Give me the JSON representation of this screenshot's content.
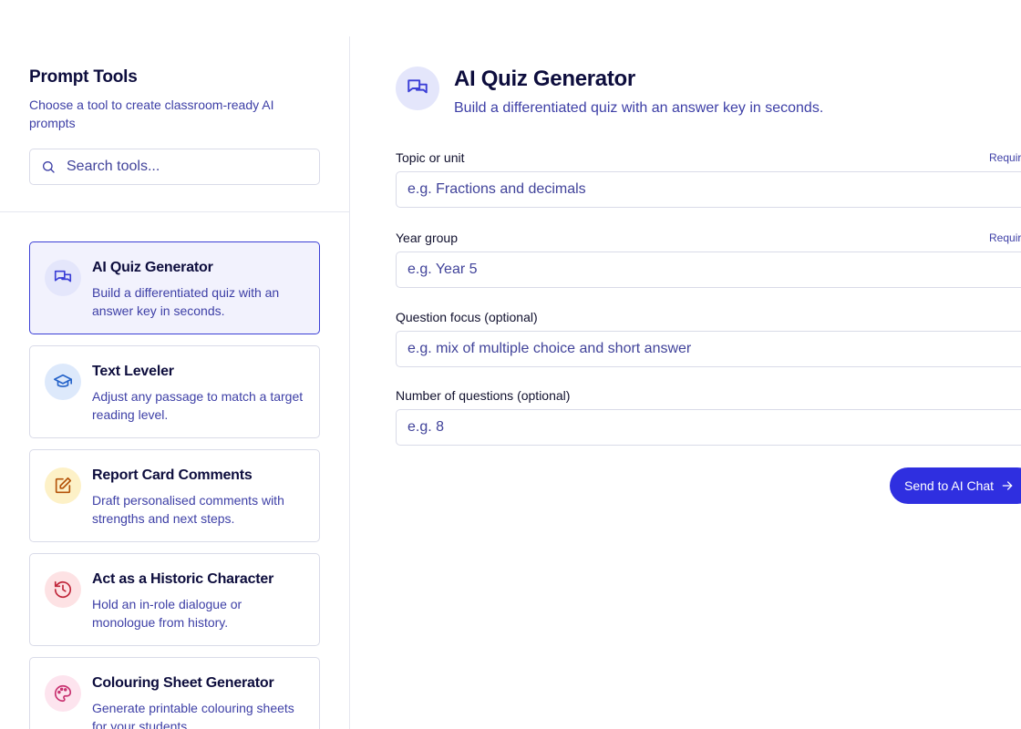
{
  "sidebar": {
    "title": "Prompt Tools",
    "subtitle": "Choose a tool to create classroom-ready AI prompts",
    "search_placeholder": "Search tools...",
    "tools": [
      {
        "name": "AI Quiz Generator",
        "description": "Build a differentiated quiz with an answer key in seconds.",
        "icon": "chat-bubbles-icon",
        "color": "#3b3fd6",
        "bg": "#e4e6fb",
        "active": true
      },
      {
        "name": "Text Leveler",
        "description": "Adjust any passage to match a target reading level.",
        "icon": "graduation-cap-icon",
        "color": "#2563c9",
        "bg": "#dde9fb",
        "active": false
      },
      {
        "name": "Report Card Comments",
        "description": "Draft personalised comments with strengths and next steps.",
        "icon": "edit-icon",
        "color": "#b45309",
        "bg": "#fdf1c7",
        "active": false
      },
      {
        "name": "Act as a Historic Character",
        "description": "Hold an in-role dialogue or monologue from history.",
        "icon": "history-icon",
        "color": "#c0263a",
        "bg": "#fde2e4",
        "active": false
      },
      {
        "name": "Colouring Sheet Generator",
        "description": "Generate printable colouring sheets for your students.",
        "icon": "palette-icon",
        "color": "#c8306f",
        "bg": "#fde4ee",
        "active": false
      }
    ]
  },
  "main": {
    "title": "AI Quiz Generator",
    "subtitle": "Build a differentiated quiz with an answer key in seconds.",
    "required_label": "Required",
    "fields": [
      {
        "label": "Topic or unit",
        "placeholder": "e.g. Fractions and decimals",
        "required": true
      },
      {
        "label": "Year group",
        "placeholder": "e.g. Year 5",
        "required": true
      },
      {
        "label": "Question focus (optional)",
        "placeholder": "e.g. mix of multiple choice and short answer",
        "required": false
      },
      {
        "label": "Number of questions (optional)",
        "placeholder": "e.g. 8",
        "required": false
      }
    ],
    "send_label": "Send to AI Chat"
  },
  "colors": {
    "accent": "#2f2fe0",
    "text": "#0d0d3d",
    "muted": "#3d3fa6"
  }
}
